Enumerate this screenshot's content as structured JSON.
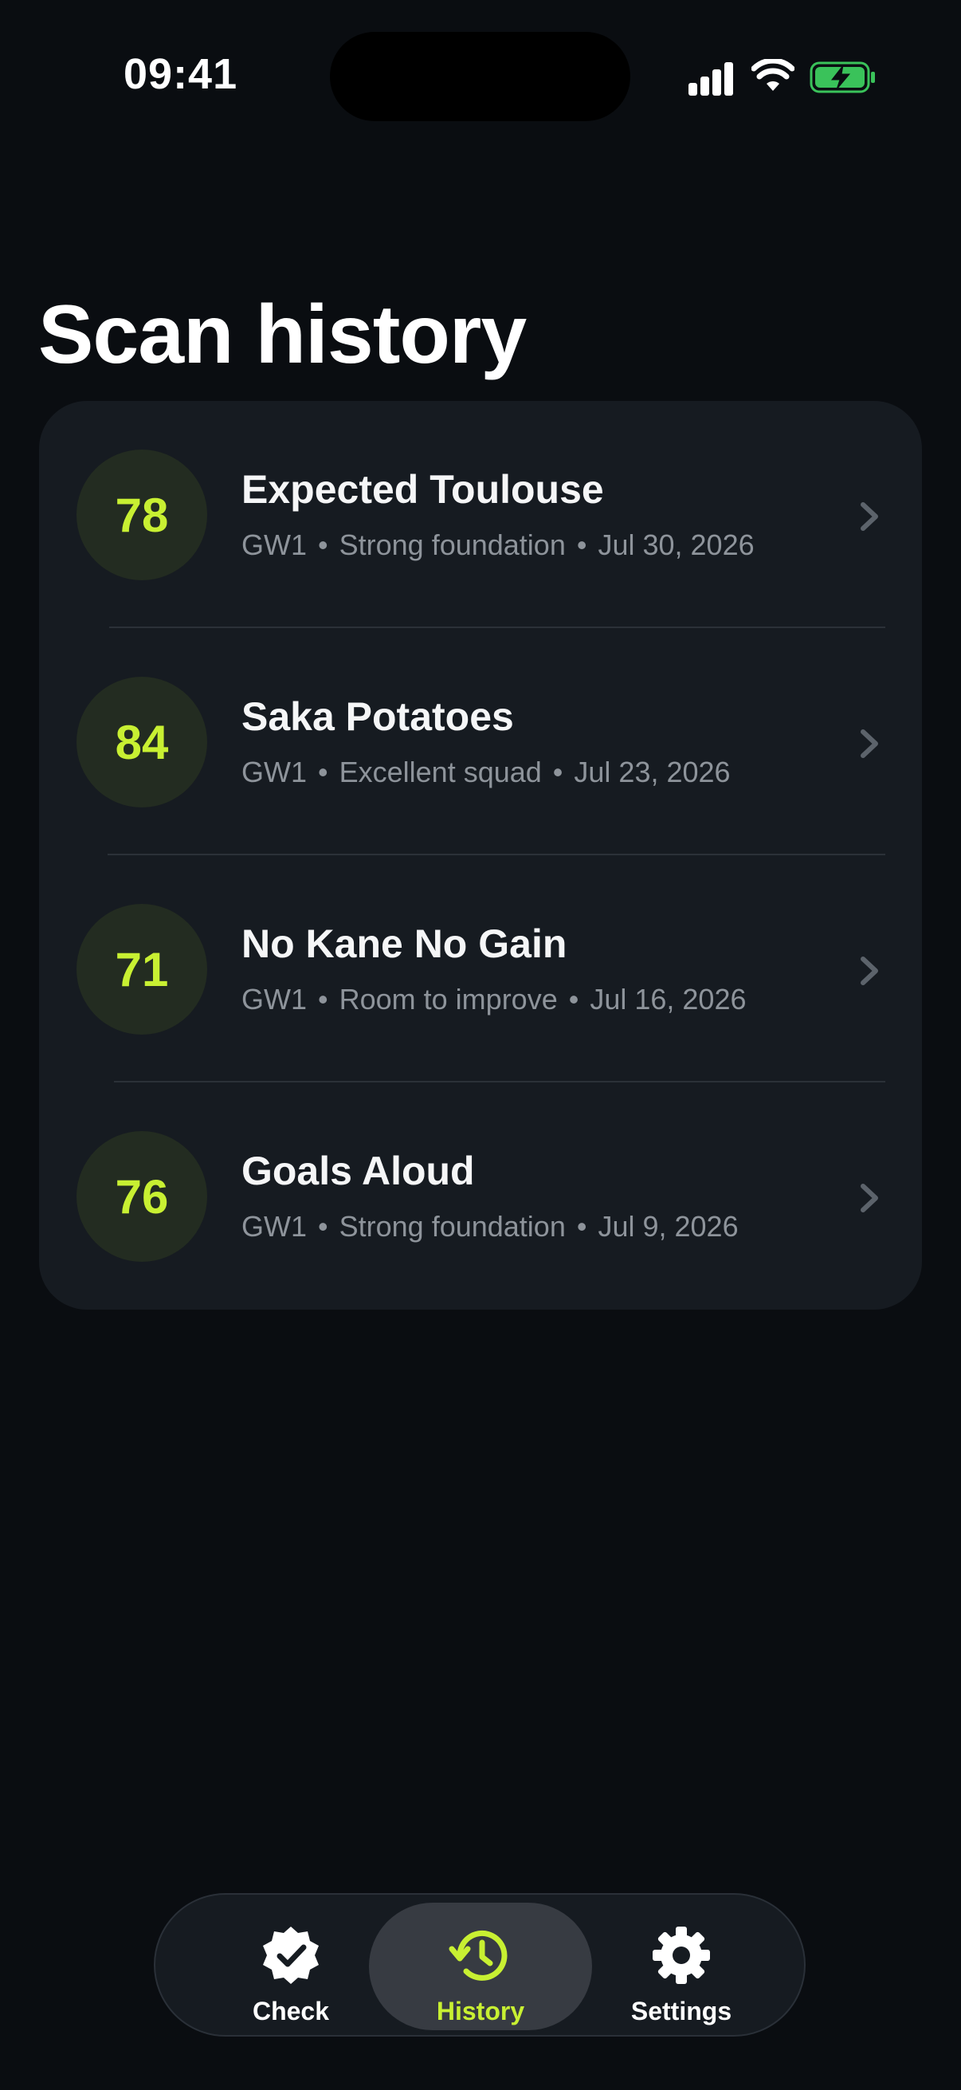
{
  "status_bar": {
    "time": "09:41"
  },
  "page": {
    "title": "Scan history"
  },
  "history": [
    {
      "score": "78",
      "team": "Expected Toulouse",
      "gw": "GW1",
      "verdict": "Strong foundation",
      "date": "Jul 30, 2026"
    },
    {
      "score": "84",
      "team": "Saka Potatoes",
      "gw": "GW1",
      "verdict": "Excellent squad",
      "date": "Jul 23, 2026"
    },
    {
      "score": "71",
      "team": "No Kane No Gain",
      "gw": "GW1",
      "verdict": "Room to improve",
      "date": "Jul 16, 2026"
    },
    {
      "score": "76",
      "team": "Goals Aloud",
      "gw": "GW1",
      "verdict": "Strong foundation",
      "date": "Jul 9, 2026"
    }
  ],
  "tabbar": {
    "tabs": [
      {
        "label": "Check",
        "icon": "badge-check-icon"
      },
      {
        "label": "History",
        "icon": "history-icon",
        "active": true
      },
      {
        "label": "Settings",
        "icon": "gear-icon"
      }
    ]
  },
  "colors": {
    "background": "#0a0d11",
    "card": "#161b21",
    "accent": "#c8f032",
    "score_bg": "#232c21",
    "muted_text": "#8e949b"
  }
}
